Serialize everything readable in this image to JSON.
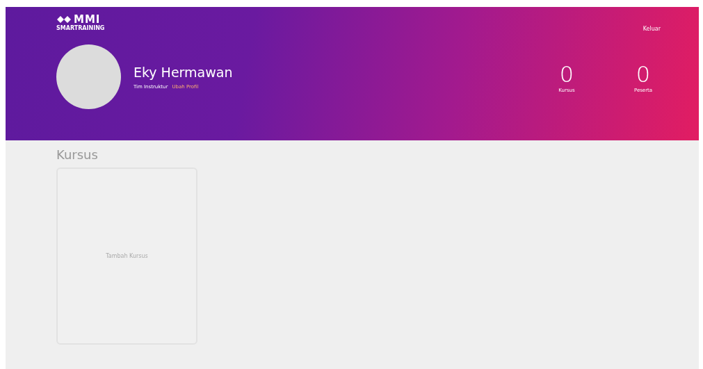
{
  "header": {
    "logo": {
      "wordmark": "MMI",
      "tagline": "SMARTRAINING"
    },
    "logout": "Keluar",
    "profile": {
      "name": "Eky Hermawan",
      "role": "Tim Instruktur",
      "edit_link": "Ubah Profil"
    },
    "stats": [
      {
        "value": "0",
        "label": "Kursus"
      },
      {
        "value": "0",
        "label": "Peserta"
      }
    ]
  },
  "section": {
    "title": "Kursus",
    "cards": [
      {
        "label": "Tambah Kursus"
      }
    ]
  }
}
